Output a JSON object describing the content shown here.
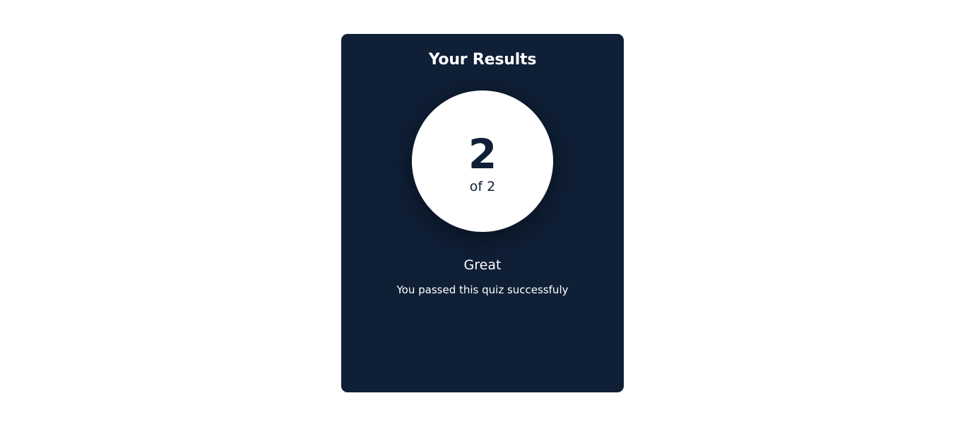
{
  "results": {
    "title": "Your Results",
    "score": "2",
    "total_label": "of 2",
    "heading": "Great",
    "message": "You passed this quiz successfuly"
  },
  "colors": {
    "card_background": "#0f1f36",
    "page_background": "#ffffff",
    "circle_background": "#ffffff",
    "text_light": "#ffffff",
    "text_dark": "#0f1f36"
  }
}
